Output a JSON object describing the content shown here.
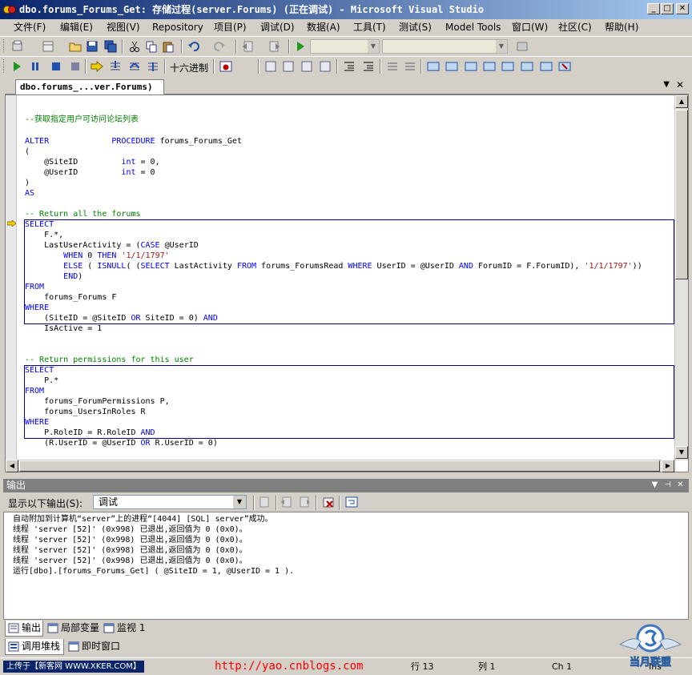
{
  "window": {
    "title": "dbo.forums_Forums_Get: 存储过程(server.Forums) (正在调试) - Microsoft Visual Studio",
    "minimize_label": "_",
    "maximize_label": "□",
    "close_label": "✕"
  },
  "menu": [
    "文件(F)",
    "编辑(E)",
    "视图(V)",
    "Repository",
    "项目(P)",
    "调试(D)",
    "数据(A)",
    "工具(T)",
    "测试(S)",
    "Model Tools",
    "窗口(W)",
    "社区(C)",
    "帮助(H)"
  ],
  "debug_toolbar": {
    "hex_label": "十六进制"
  },
  "document_tab": {
    "label": "dbo.forums_...ver.Forums)",
    "close_label": "✕",
    "dropdown_label": "▼"
  },
  "code_lines": [
    {
      "segments": [
        {
          "t": "--获取指定用户可访问论坛列表",
          "c": "cm"
        }
      ]
    },
    {
      "segments": [
        {
          "t": "ALTER",
          "c": "kw"
        },
        {
          "t": "             "
        },
        {
          "t": "PROCEDURE",
          "c": "kw"
        },
        {
          "t": " forums_Forums_Get"
        }
      ]
    },
    {
      "segments": [
        {
          "t": "("
        }
      ]
    },
    {
      "segments": [
        {
          "t": "    @SiteID         "
        },
        {
          "t": "int",
          "c": "kw"
        },
        {
          "t": " = 0,"
        }
      ]
    },
    {
      "segments": [
        {
          "t": "    @UserID         "
        },
        {
          "t": "int",
          "c": "kw"
        },
        {
          "t": " = 0"
        }
      ]
    },
    {
      "segments": [
        {
          "t": ")"
        }
      ]
    },
    {
      "segments": [
        {
          "t": "AS",
          "c": "kw"
        }
      ]
    },
    {
      "segments": [
        {
          "t": "-- Return all the forums",
          "c": "cm"
        }
      ]
    },
    {
      "segments": [
        {
          "t": "SELECT",
          "c": "kw"
        }
      ]
    },
    {
      "segments": [
        {
          "t": "    F.*,"
        }
      ]
    },
    {
      "segments": [
        {
          "t": "    LastUserActivity = ("
        },
        {
          "t": "CASE",
          "c": "kw"
        },
        {
          "t": " @UserID"
        }
      ]
    },
    {
      "segments": [
        {
          "t": "        "
        },
        {
          "t": "WHEN",
          "c": "kw"
        },
        {
          "t": " 0 "
        },
        {
          "t": "THEN",
          "c": "kw"
        },
        {
          "t": " "
        },
        {
          "t": "'1/1/1797'",
          "c": "st"
        }
      ]
    },
    {
      "segments": [
        {
          "t": "        "
        },
        {
          "t": "ELSE",
          "c": "kw"
        },
        {
          "t": " ( "
        },
        {
          "t": "ISNULL",
          "c": "kw"
        },
        {
          "t": "( ("
        },
        {
          "t": "SELECT",
          "c": "kw"
        },
        {
          "t": " LastActivity "
        },
        {
          "t": "FROM",
          "c": "kw"
        },
        {
          "t": " forums_ForumsRead "
        },
        {
          "t": "WHERE",
          "c": "kw"
        },
        {
          "t": " UserID = @UserID "
        },
        {
          "t": "AND",
          "c": "kw"
        },
        {
          "t": " ForumID = F.ForumID), "
        },
        {
          "t": "'1/1/1797'",
          "c": "st"
        },
        {
          "t": "))"
        }
      ]
    },
    {
      "segments": [
        {
          "t": "        "
        },
        {
          "t": "END",
          "c": "kw"
        },
        {
          "t": ")"
        }
      ]
    },
    {
      "segments": [
        {
          "t": "FROM",
          "c": "kw"
        }
      ]
    },
    {
      "segments": [
        {
          "t": "    forums_Forums F"
        }
      ]
    },
    {
      "segments": [
        {
          "t": "WHERE",
          "c": "kw"
        }
      ]
    },
    {
      "segments": [
        {
          "t": "    (SiteID = @SiteID "
        },
        {
          "t": "OR",
          "c": "kw"
        },
        {
          "t": " SiteID = 0) "
        },
        {
          "t": "AND",
          "c": "kw"
        }
      ]
    },
    {
      "segments": [
        {
          "t": "    IsActive = 1"
        }
      ]
    },
    {
      "segments": [
        {
          "t": "-- Return permissions for this user",
          "c": "cm"
        }
      ]
    },
    {
      "segments": [
        {
          "t": "SELECT",
          "c": "kw"
        }
      ]
    },
    {
      "segments": [
        {
          "t": "    P.*"
        }
      ]
    },
    {
      "segments": [
        {
          "t": "FROM",
          "c": "kw"
        }
      ]
    },
    {
      "segments": [
        {
          "t": "    forums_ForumPermissions P,"
        }
      ]
    },
    {
      "segments": [
        {
          "t": "    forums_UsersInRoles R"
        }
      ]
    },
    {
      "segments": [
        {
          "t": "WHERE",
          "c": "kw"
        }
      ]
    },
    {
      "segments": [
        {
          "t": "    P.RoleID = R.RoleID "
        },
        {
          "t": "AND",
          "c": "kw"
        }
      ]
    },
    {
      "segments": [
        {
          "t": "    (R.UserID = @UserID "
        },
        {
          "t": "OR",
          "c": "kw"
        },
        {
          "t": " R.UserID = 0)"
        }
      ]
    }
  ],
  "output_panel": {
    "title": "输出",
    "show_output_from_label": "显示以下输出(S):",
    "show_output_from_value": "调试",
    "lines": [
      "自动附加到计算机“server”上的进程“[4044] [SQL] server”成功。",
      "线程 'server [52]' (0x998) 已退出,返回值为 0 (0x0)。",
      "线程 'server [52]' (0x998) 已退出,返回值为 0 (0x0)。",
      "线程 'server [52]' (0x998) 已退出,返回值为 0 (0x0)。",
      "线程 'server [52]' (0x998) 已退出,返回值为 0 (0x0)。",
      "运行[dbo].[forums_Forums_Get] ( @SiteID = 1, @UserID = 1 )."
    ]
  },
  "bottom_tabs": {
    "output": "输出",
    "locals": "局部变量",
    "watch": "监视 1",
    "call_stack": "调用堆栈",
    "immediate": "即时窗口"
  },
  "status": {
    "left_label": "上传于【新客网 WWW.XKER.COM】",
    "url": "http://yao.cnblogs.com",
    "line": "行 13",
    "col": "列 1",
    "ch": "Ch 1",
    "ins": "Ins"
  },
  "watermark_text": "当月联盟",
  "colors": {
    "keyword": "#0000ff",
    "comment": "#008000",
    "string": "#a31515",
    "title_start": "#0a246a",
    "title_end": "#a6caf0",
    "url": "#ff0000"
  }
}
